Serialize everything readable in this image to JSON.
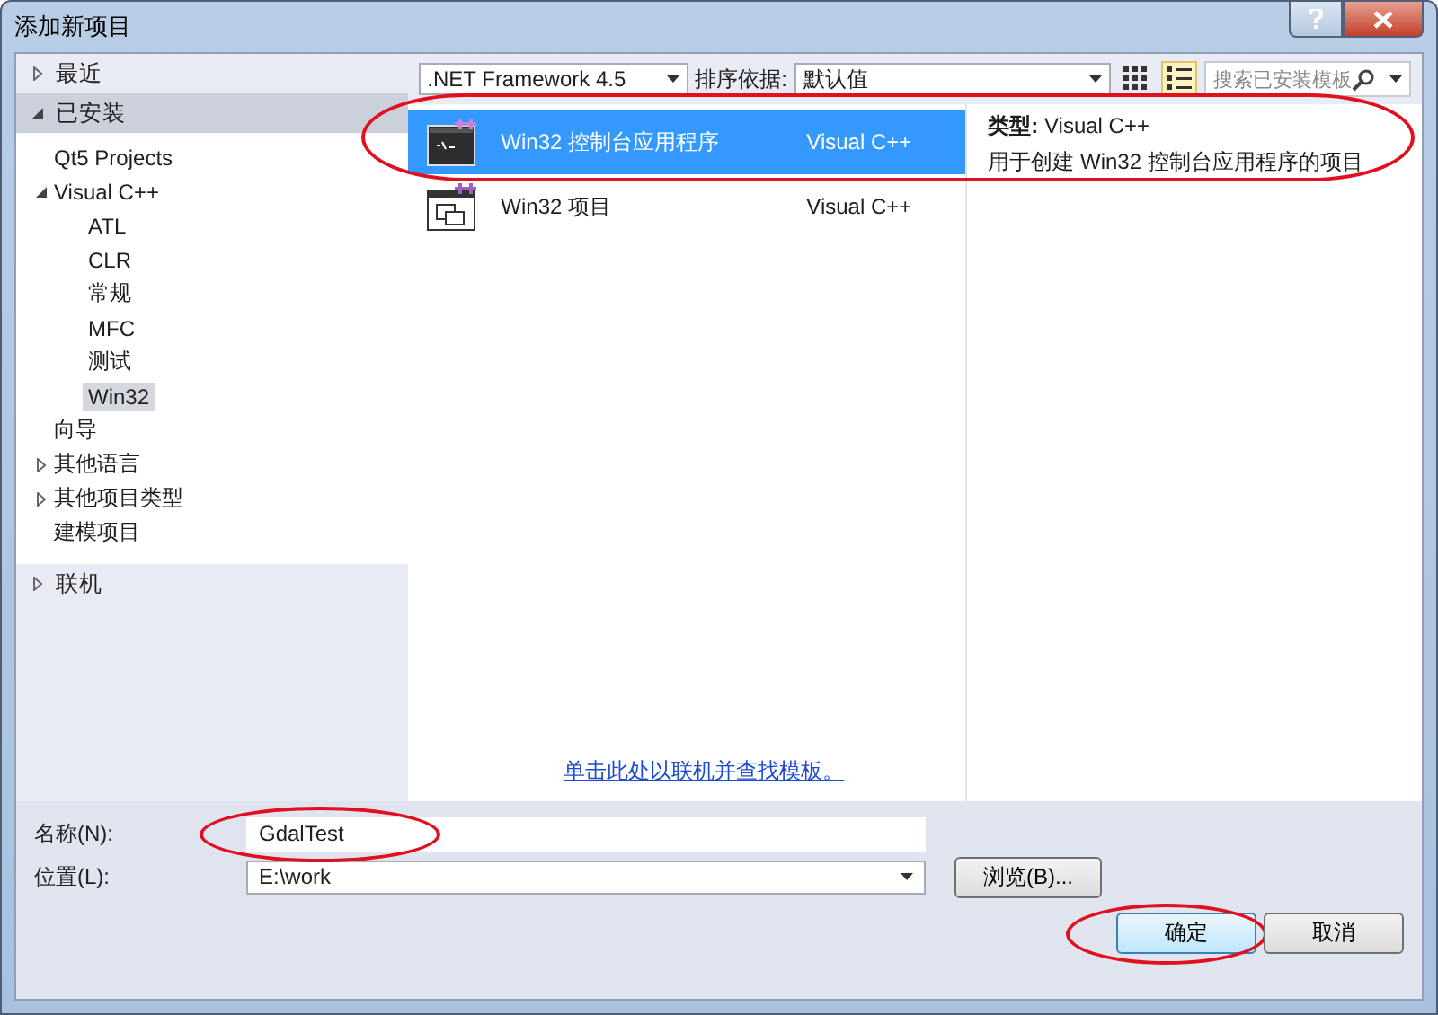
{
  "window": {
    "title": "添加新项目"
  },
  "sidebar": {
    "sections": [
      {
        "label": "最近",
        "expanded": false,
        "selected": false
      },
      {
        "label": "已安装",
        "expanded": true,
        "selected": true,
        "children": [
          {
            "label": "Qt5 Projects",
            "selected": false
          },
          {
            "label": "Visual C++",
            "expanded": true,
            "selected": false,
            "children": [
              {
                "label": "ATL",
                "selected": false
              },
              {
                "label": "CLR",
                "selected": false
              },
              {
                "label": "常规",
                "selected": false
              },
              {
                "label": "MFC",
                "selected": false
              },
              {
                "label": "测试",
                "selected": false
              },
              {
                "label": "Win32",
                "selected": true
              }
            ]
          },
          {
            "label": "向导",
            "selected": false
          },
          {
            "label": "其他语言",
            "expanded": false,
            "selected": false
          },
          {
            "label": "其他项目类型",
            "expanded": false,
            "selected": false
          },
          {
            "label": "建模项目",
            "selected": false
          }
        ]
      },
      {
        "label": "联机",
        "expanded": false,
        "selected": false
      }
    ]
  },
  "toolbar": {
    "framework": ".NET Framework 4.5",
    "sort_label": "排序依据:",
    "sort_value": "默认值",
    "views": [
      {
        "kind": "grid",
        "selected": false
      },
      {
        "kind": "list",
        "selected": true
      }
    ],
    "search": {
      "placeholder": "搜索已安装模板"
    }
  },
  "templates": [
    {
      "kind": "console",
      "name": "Win32 控制台应用程序",
      "language": "Visual C++",
      "selected": true,
      "circled": true
    },
    {
      "kind": "project",
      "name": "Win32 项目",
      "language": "Visual C++",
      "selected": false,
      "circled": false
    }
  ],
  "online_link": "单击此处以联机并查找模板。",
  "details": {
    "type_label": "类型:",
    "type_value": "Visual C++",
    "description": "用于创建 Win32 控制台应用程序的项目"
  },
  "form": {
    "name_label": "名称(N):",
    "name_value": "GdalTest",
    "name_circled": true,
    "location_label": "位置(L):",
    "location_value": "E:\\work",
    "browse": "浏览(B)..."
  },
  "buttons": [
    {
      "label": "确定",
      "default": true,
      "circled": true
    },
    {
      "label": "取消",
      "default": false,
      "circled": false
    }
  ]
}
